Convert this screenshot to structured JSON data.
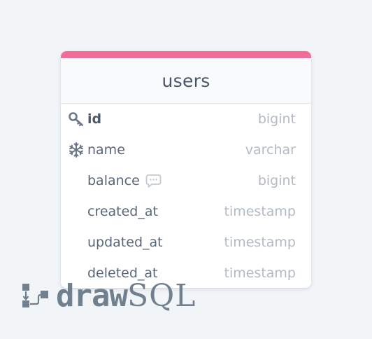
{
  "table": {
    "name": "users",
    "accent_color": "#f16d97",
    "columns": [
      {
        "name": "id",
        "type": "bigint",
        "icon": "key-icon",
        "primary": true
      },
      {
        "name": "name",
        "type": "varchar",
        "icon": "snowflake-icon"
      },
      {
        "name": "balance",
        "type": "bigint",
        "comment_icon": "comment-icon"
      },
      {
        "name": "created_at",
        "type": "timestamp"
      },
      {
        "name": "updated_at",
        "type": "timestamp"
      },
      {
        "name": "deleted_at",
        "type": "timestamp"
      }
    ]
  },
  "brand": {
    "logo_icon": "drawsql-logo-icon",
    "part1": "draw",
    "part2": "SQL"
  }
}
